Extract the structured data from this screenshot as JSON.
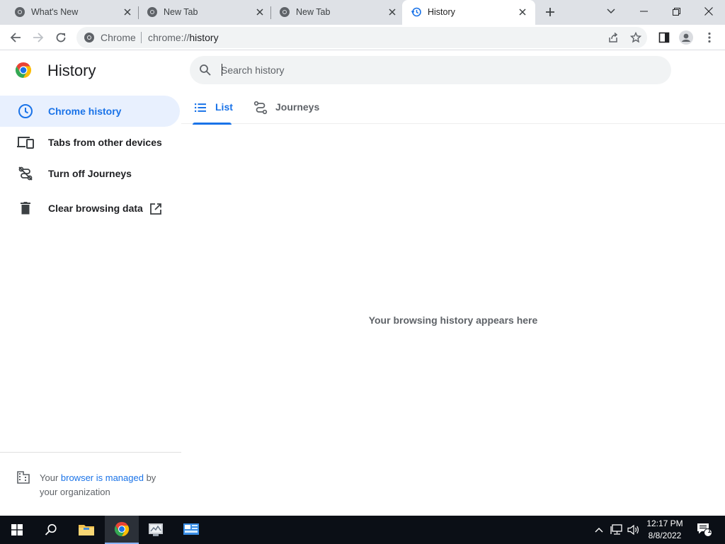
{
  "window": {
    "tabs": [
      {
        "title": "What's New",
        "active": false
      },
      {
        "title": "New Tab",
        "active": false
      },
      {
        "title": "New Tab",
        "active": false
      },
      {
        "title": "History",
        "active": true
      }
    ],
    "new_tab_icon": "plus-icon",
    "controls": [
      "chevron-down-icon",
      "minimize-icon",
      "restore-icon",
      "close-icon"
    ]
  },
  "toolbar": {
    "chip_label": "Chrome",
    "url_scheme": "chrome://",
    "url_path": "history"
  },
  "page": {
    "title": "History",
    "search_placeholder": "Search history",
    "sidebar": {
      "items": [
        {
          "label": "Chrome history",
          "icon": "clock-icon",
          "selected": true
        },
        {
          "label": "Tabs from other devices",
          "icon": "devices-icon",
          "selected": false
        },
        {
          "label": "Turn off Journeys",
          "icon": "journeys-off-icon",
          "selected": false
        },
        {
          "label": "Clear browsing data",
          "icon": "trash-icon",
          "selected": false
        }
      ],
      "managed": {
        "prefix": "Your ",
        "link": "browser is managed",
        "suffix": " by your organization"
      }
    },
    "tabs": [
      {
        "label": "List",
        "active": true
      },
      {
        "label": "Journeys",
        "active": false
      }
    ],
    "empty_message": "Your browsing history appears here"
  },
  "taskbar": {
    "apps": [
      "windows-start-icon",
      "search-icon",
      "file-explorer-icon",
      "chrome-icon",
      "server-manager-icon",
      "control-panel-icon"
    ],
    "time": "12:17 PM",
    "date": "8/8/2022",
    "notification_count": "1"
  },
  "colors": {
    "accent": "#1a73e8",
    "selected_bg": "#e8f0fe",
    "tabstrip_bg": "#dee1e6",
    "taskbar_bg": "#0b0f16"
  }
}
